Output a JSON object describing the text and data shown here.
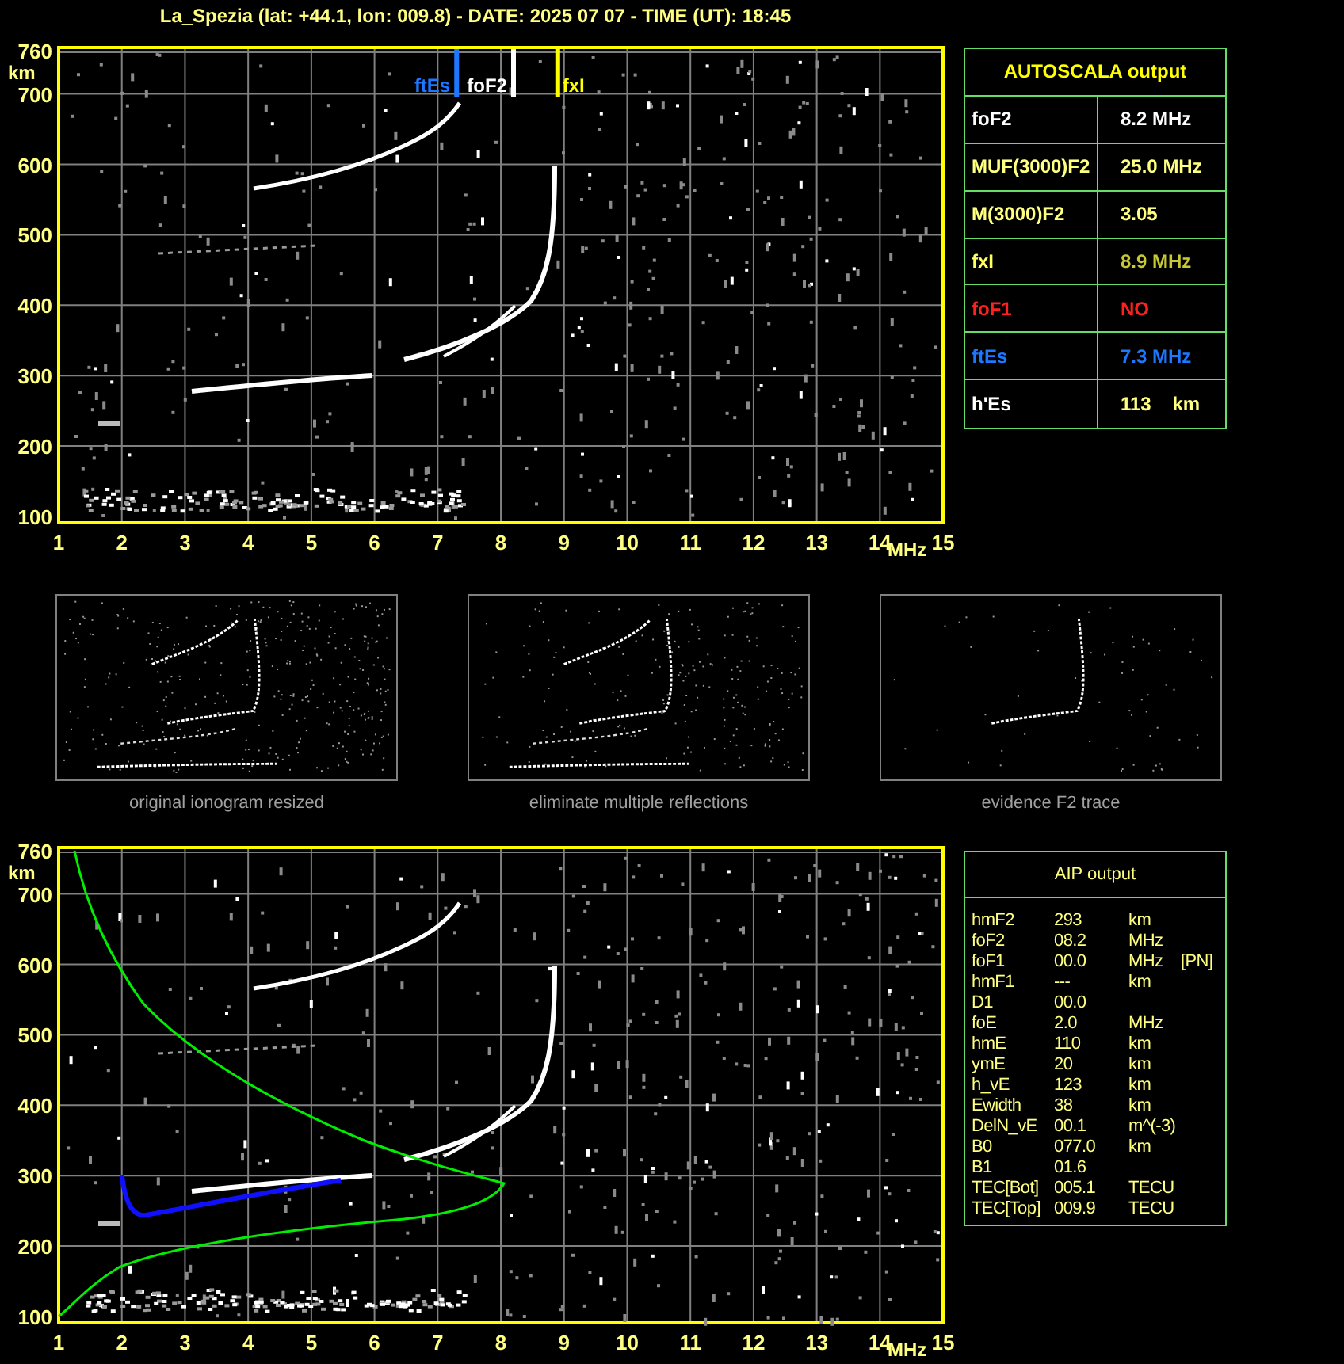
{
  "title": "La_Spezia (lat: +44.1, lon: 009.8) - DATE: 2025 07 07 - TIME (UT): 18:45",
  "ionogram": {
    "y_ticks": [
      "760",
      "700",
      "600",
      "500",
      "400",
      "300",
      "200",
      "100"
    ],
    "y_unit": "km",
    "x_ticks": [
      "1",
      "2",
      "3",
      "4",
      "5",
      "6",
      "7",
      "8",
      "9",
      "10",
      "11",
      "12",
      "13",
      "14",
      "15"
    ],
    "x_unit": "MHz",
    "markers": [
      {
        "label": "ftEs",
        "color": "#1e78ff"
      },
      {
        "label": "foF2",
        "color": "#ffffff"
      },
      {
        "label": "fxI",
        "color": "#ffff00"
      }
    ]
  },
  "autoscala": {
    "title": "AUTOSCALA output",
    "rows": [
      {
        "label": {
          "text": "foF2",
          "color": "#ffffff"
        },
        "value": {
          "text": "8.2 MHz",
          "color": "#ffffff"
        }
      },
      {
        "label": {
          "text": "MUF(3000)F2",
          "color": "#ffff80"
        },
        "value": {
          "text": "25.0 MHz",
          "color": "#ffff80"
        }
      },
      {
        "label": {
          "text": "M(3000)F2",
          "color": "#ffff80"
        },
        "value": {
          "text": "3.05",
          "color": "#ffff80"
        }
      },
      {
        "label": {
          "text": "fxI",
          "color": "#ffff60"
        },
        "value": {
          "text": "8.9 MHz",
          "color": "#c8c832"
        }
      },
      {
        "label": {
          "text": "foF1",
          "color": "#ff2020"
        },
        "value": {
          "text": "NO",
          "color": "#ff2020"
        }
      },
      {
        "label": {
          "text": "ftEs",
          "color": "#1e78ff"
        },
        "value": {
          "text": "7.3 MHz",
          "color": "#1e78ff"
        }
      },
      {
        "label": {
          "text": "h'Es",
          "color": "#ffffff"
        },
        "value": {
          "text": "113    km",
          "color": "#ffff80"
        }
      }
    ]
  },
  "thumbnails": [
    {
      "caption": "original ionogram resized"
    },
    {
      "caption": "eliminate multiple reflections"
    },
    {
      "caption": "evidence F2 trace"
    }
  ],
  "aip_ionogram": {
    "y_ticks": [
      "760",
      "700",
      "600",
      "500",
      "400",
      "300",
      "200",
      "100"
    ],
    "y_unit": "km",
    "x_ticks": [
      "1",
      "2",
      "3",
      "4",
      "5",
      "6",
      "7",
      "8",
      "9",
      "10",
      "11",
      "12",
      "13",
      "14",
      "15"
    ],
    "x_unit": "MHz"
  },
  "aip": {
    "title": "AIP output",
    "rows": [
      {
        "name": "hmF2",
        "value": "293",
        "unit": "km"
      },
      {
        "name": "foF2",
        "value": "08.2",
        "unit": "MHz"
      },
      {
        "name": "foF1",
        "value": "00.0",
        "unit": "MHz",
        "note": "[PN]"
      },
      {
        "name": "hmF1",
        "value": "---",
        "unit": "km"
      },
      {
        "name": "D1",
        "value": "00.0"
      },
      {
        "name": "foE",
        "value": "2.0",
        "unit": "MHz"
      },
      {
        "name": "hmE",
        "value": "110",
        "unit": "km"
      },
      {
        "name": "ymE",
        "value": "20",
        "unit": "km"
      },
      {
        "name": "h_vE",
        "value": "123",
        "unit": "km"
      },
      {
        "name": "Ewidth",
        "value": "38",
        "unit": "km"
      },
      {
        "name": "DelN_vE",
        "value": "00.1",
        "unit": "m^(-3)"
      },
      {
        "name": "B0",
        "value": "077.0",
        "unit": "km"
      },
      {
        "name": "B1",
        "value": "01.6"
      },
      {
        "name": "TEC[Bot]",
        "value": "005.1",
        "unit": "TECU"
      },
      {
        "name": "TEC[Top]",
        "value": "009.9",
        "unit": "TECU"
      }
    ]
  }
}
